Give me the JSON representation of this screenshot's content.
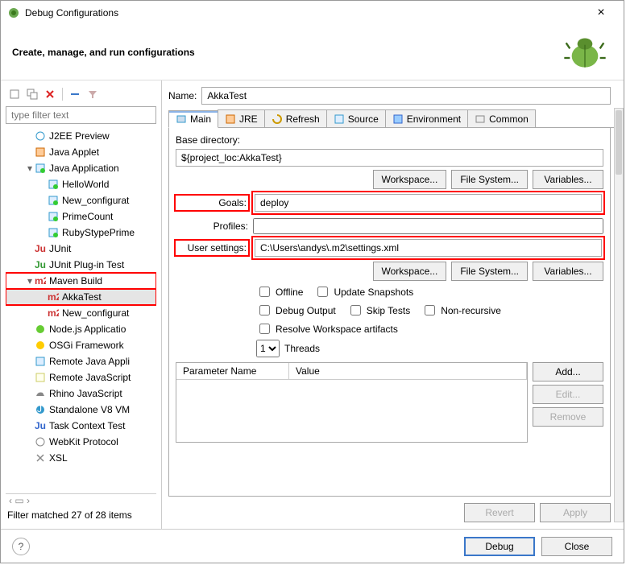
{
  "window": {
    "title": "Debug Configurations",
    "subtitle": "Create, manage, and run configurations"
  },
  "left": {
    "filter_placeholder": "type filter text",
    "items": [
      {
        "label": "J2EE Preview",
        "icon": "globe",
        "indent": 1
      },
      {
        "label": "Java Applet",
        "icon": "applet",
        "indent": 1
      },
      {
        "label": "Java Application",
        "icon": "java-run",
        "indent": 1,
        "twisty": "▾"
      },
      {
        "label": "HelloWorld",
        "icon": "java-run",
        "indent": 2
      },
      {
        "label": "New_configurat",
        "icon": "java-run",
        "indent": 2
      },
      {
        "label": "PrimeCount",
        "icon": "java-run",
        "indent": 2
      },
      {
        "label": "RubyStypePrime",
        "icon": "java-run",
        "indent": 2
      },
      {
        "label": "JUnit",
        "icon": "junit",
        "indent": 1
      },
      {
        "label": "JUnit Plug-in Test",
        "icon": "junit-plug",
        "indent": 1
      },
      {
        "label": "Maven Build",
        "icon": "m2",
        "indent": 1,
        "twisty": "▾",
        "highlight": true
      },
      {
        "label": "AkkaTest",
        "icon": "m2",
        "indent": 2,
        "highlight": true,
        "selected": true
      },
      {
        "label": "New_configurat",
        "icon": "m2",
        "indent": 2
      },
      {
        "label": "Node.js Applicatio",
        "icon": "node",
        "indent": 1
      },
      {
        "label": "OSGi Framework",
        "icon": "osgi",
        "indent": 1
      },
      {
        "label": "Remote Java Appli",
        "icon": "remote-java",
        "indent": 1
      },
      {
        "label": "Remote JavaScript",
        "icon": "remote-js",
        "indent": 1
      },
      {
        "label": "Rhino JavaScript",
        "icon": "rhino",
        "indent": 1
      },
      {
        "label": "Standalone V8 VM",
        "icon": "v8",
        "indent": 1
      },
      {
        "label": "Task Context Test",
        "icon": "task",
        "indent": 1
      },
      {
        "label": "WebKit Protocol",
        "icon": "webkit",
        "indent": 1
      },
      {
        "label": "XSL",
        "icon": "xsl",
        "indent": 1
      }
    ],
    "filter_match": "Filter matched 27 of 28 items"
  },
  "form": {
    "name_label": "Name:",
    "name_value": "AkkaTest",
    "tabs": [
      {
        "label": "Main",
        "icon": "main",
        "active": true
      },
      {
        "label": "JRE",
        "icon": "jre"
      },
      {
        "label": "Refresh",
        "icon": "refresh"
      },
      {
        "label": "Source",
        "icon": "source"
      },
      {
        "label": "Environment",
        "icon": "env"
      },
      {
        "label": "Common",
        "icon": "common"
      }
    ],
    "basedir_label": "Base directory:",
    "basedir_value": "${project_loc:AkkaTest}",
    "buttons": {
      "workspace": "Workspace...",
      "filesystem": "File System...",
      "variables": "Variables..."
    },
    "goals_label": "Goals:",
    "goals_value": "deploy",
    "profiles_label": "Profiles:",
    "profiles_value": "",
    "user_settings_label": "User settings:",
    "user_settings_value": "C:\\Users\\andys\\.m2\\settings.xml",
    "checks": {
      "offline": "Offline",
      "update_snapshots": "Update Snapshots",
      "debug_output": "Debug Output",
      "skip_tests": "Skip Tests",
      "non_recursive": "Non-recursive",
      "resolve_workspace": "Resolve Workspace artifacts"
    },
    "threads": {
      "value": "1",
      "label": "Threads"
    },
    "param_headers": {
      "name": "Parameter Name",
      "value": "Value"
    },
    "param_actions": {
      "add": "Add...",
      "edit": "Edit...",
      "remove": "Remove"
    },
    "revert": "Revert",
    "apply": "Apply"
  },
  "footer": {
    "debug": "Debug",
    "close": "Close"
  }
}
